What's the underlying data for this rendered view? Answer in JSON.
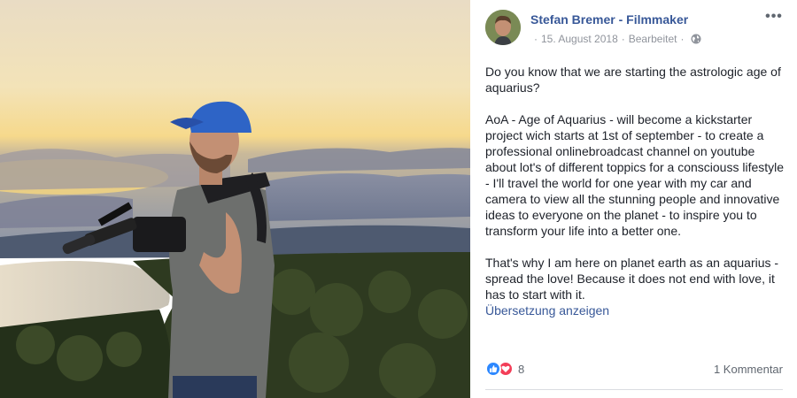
{
  "post": {
    "author": "Stefan Bremer - Filmmaker",
    "date": "15. August 2018",
    "separator": "·",
    "edited": "Bearbeitet",
    "privacy_icon": "globe-icon",
    "more_icon": "more-horizontal-icon",
    "paragraphs": [
      "Do you know that we are starting the astrologic age of aquarius?",
      "AoA - Age of Aquarius - will become a kickstarter project wich starts at 1st of september - to create a professional onlinebroadcast channel on youtube about lot's of different toppics for a consciouss lifestyle - I'll travel the world for one year with my car and camera to view all the stunning people and innovative ideas to everyone on the planet - to inspire you to transform your life into a better one.",
      "That's why I am here on planet earth as an aquarius - spread the love! Because it does not end with love, it has to start with it."
    ],
    "translate_link": "Übersetzung anzeigen"
  },
  "footer": {
    "reaction_icons": [
      "like-icon",
      "love-icon"
    ],
    "reaction_count": "8",
    "comment_count": "1 Kommentar"
  },
  "colors": {
    "link": "#385898",
    "text": "#1d2129",
    "muted": "#90949c",
    "like": "#2d88ff",
    "love": "#f33e58"
  }
}
